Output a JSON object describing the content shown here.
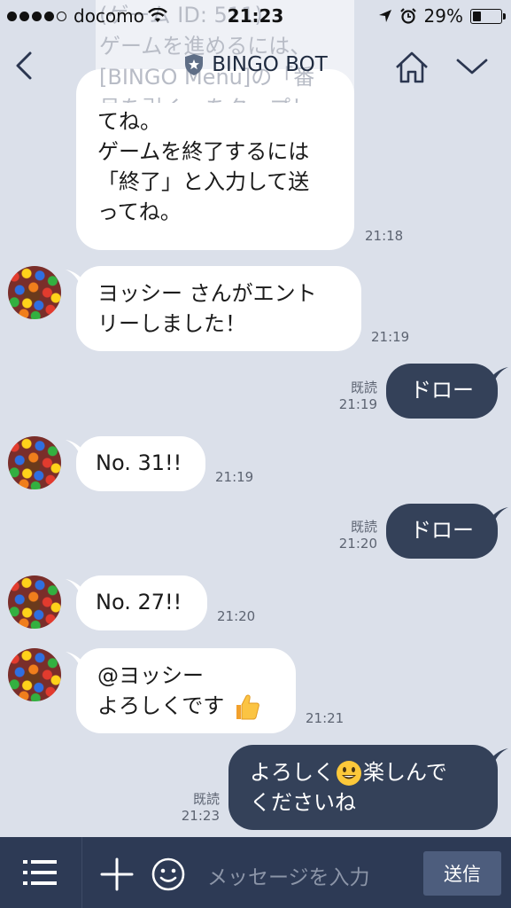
{
  "status_bar": {
    "carrier": "docomo",
    "time": "21:23",
    "battery": "29%",
    "battery_level": 0.29
  },
  "header": {
    "title": "BINGO BOT",
    "ghost_lines": [
      "(ゲーム ID: 511)",
      "ゲームを進めるには、",
      "[BINGO Menu]の「番",
      "号を引く」をタップし"
    ]
  },
  "messages": {
    "m1": {
      "lines": [
        "てね。",
        "ゲームを終了するには",
        "「終了」と入力して送",
        "ってね。"
      ],
      "time": "21:18"
    },
    "m2": {
      "lines": [
        "ヨッシー さんがエント",
        "リーしました！"
      ],
      "time": "21:19"
    },
    "m3": {
      "text": "ドロー",
      "read": "既読",
      "time": "21:19"
    },
    "m4": {
      "text": "No. 31!!",
      "time": "21:19"
    },
    "m5": {
      "text": "ドロー",
      "read": "既読",
      "time": "21:20"
    },
    "m6": {
      "text": "No. 27!!",
      "time": "21:20"
    },
    "m7": {
      "line1": "@ヨッシー",
      "line2": "よろしくです",
      "time": "21:21"
    },
    "m8": {
      "line1a": "よろしく",
      "line1b": "楽しんで",
      "line2": "くださいね",
      "read": "既読",
      "time": "21:23"
    }
  },
  "input_bar": {
    "placeholder": "メッセージを入力",
    "send_label": "送信"
  },
  "colors": {
    "background": "#dbe0ea",
    "outgoing_bubble": "#344159",
    "input_bar": "#2d3a55",
    "send_button": "#4d5d7d"
  }
}
